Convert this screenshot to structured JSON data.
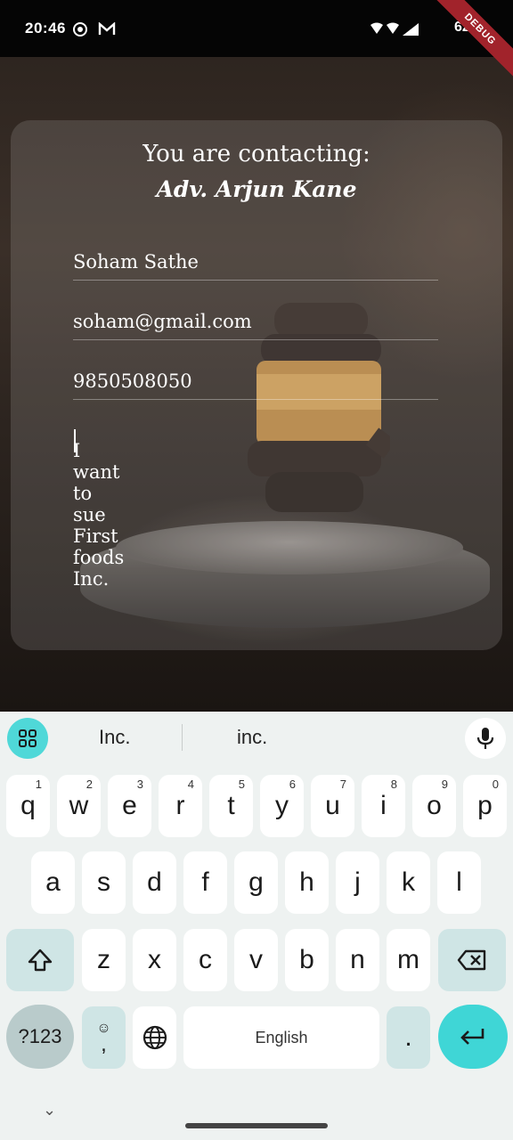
{
  "status_bar": {
    "time": "20:46",
    "battery": "62%",
    "debug_label": "DEBUG"
  },
  "contact": {
    "heading": "You are contacting:",
    "lawyer_name": "Adv. Arjun Kane"
  },
  "form": {
    "name_value": "Soham Sathe",
    "email_value": "soham@gmail.com",
    "phone_value": "9850508050",
    "message_value": "I want to sue First foods Inc."
  },
  "keyboard": {
    "suggestions": [
      "Inc.",
      "inc."
    ],
    "row1": [
      {
        "label": "q",
        "hint": "1"
      },
      {
        "label": "w",
        "hint": "2"
      },
      {
        "label": "e",
        "hint": "3"
      },
      {
        "label": "r",
        "hint": "4"
      },
      {
        "label": "t",
        "hint": "5"
      },
      {
        "label": "y",
        "hint": "6"
      },
      {
        "label": "u",
        "hint": "7"
      },
      {
        "label": "i",
        "hint": "8"
      },
      {
        "label": "o",
        "hint": "9"
      },
      {
        "label": "p",
        "hint": "0"
      }
    ],
    "row2": [
      "a",
      "s",
      "d",
      "f",
      "g",
      "h",
      "j",
      "k",
      "l"
    ],
    "row3": [
      "z",
      "x",
      "c",
      "v",
      "b",
      "n",
      "m"
    ],
    "symbols_label": "?123",
    "comma_label": ",",
    "space_label": "English",
    "period_label": ".",
    "accent_color": "#3fd6d6"
  }
}
